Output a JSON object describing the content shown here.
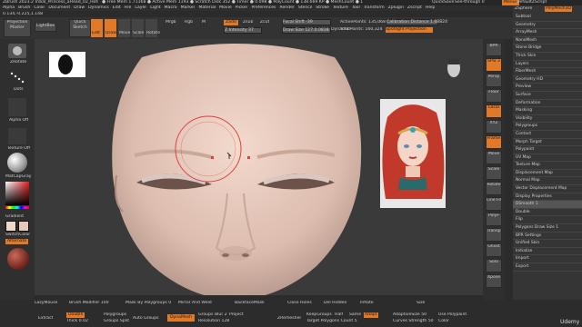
{
  "title_bar": {
    "app": "ZBrush 2023.2",
    "file": "Tribal_Princess_aHead_02_Hotsby",
    "stats": "● Free Mem 1.71168 ● Active Mem 1193 ● Scratch Disk 352 ● Timer ● 0.098 ● PolyCount ● 138.669 KP ● MeshCount ● 1",
    "quicksave": "QuickSave",
    "seethrough": "See-through  0",
    "menus_btn": "Menus",
    "script": "DefaultZScript"
  },
  "menu_bar": [
    "Alpha",
    "Brush",
    "Color",
    "Document",
    "Draw",
    "Dynamics",
    "Edit",
    "File",
    "Layer",
    "Light",
    "Macro",
    "Marker",
    "Material",
    "Movie",
    "Picker",
    "Preferences",
    "Render",
    "Stencil",
    "Stroke",
    "Texture",
    "Tool",
    "Transform",
    "Zplugin",
    "Zscript",
    "Help"
  ],
  "coords": "0.134,-0.225,1.148",
  "top_shelf": {
    "projection_master": "Projection Master",
    "lightbox": "LightBox",
    "quick_sketch": "Quick Sketch",
    "tools": [
      "Edit",
      "Draw",
      "Move",
      "Scale",
      "Rotate"
    ],
    "mrgb": "Mrgb",
    "rgb": "Rgb",
    "m": "M",
    "zadd": "Zadd",
    "zsub": "Zsub",
    "zcut": "Zcut",
    "z_intensity": "Z Intensity 37",
    "focal_shift": "Focal Shift -39",
    "draw_size": "Draw Size 127.0.0838",
    "dynamic": "Dynamic",
    "active_points": "ActivePoints: 135,068",
    "total_points": "TotalPoints: 160,324",
    "calibration": "Calibration Distance 1.68824",
    "spotlight": "Spotlight Projection"
  },
  "left_shelf": {
    "brush_label": "ZRotate",
    "stroke_label": "Dots",
    "alpha_label": "Alpha Off",
    "texture_label": "Texture Off",
    "material_label": "MatCapGray",
    "gradient": "Gradient",
    "switch_color": "SwitchColor",
    "alternate": "Alternate",
    "skin_shade": "BasicMaterial"
  },
  "right_shelf": {
    "buttons": [
      "BPR",
      "SPix 3",
      "Persp",
      "Floor",
      "Local",
      "XYZ",
      "Frame",
      "Move",
      "Scale",
      "Rotate",
      "Line Fill",
      "PolyF",
      "Transp",
      "Ghost",
      "Solo",
      "Xpose"
    ]
  },
  "subtool_menu": {
    "header_left": "ZSphere",
    "header_right": "PolyMesh3D",
    "items": [
      "Subtool",
      "Geometry",
      "ArrayMesh",
      "NanoMesh",
      "Stone Bridge",
      "Thick Skin",
      "Layers",
      "FiberMesh",
      "Geometry HD",
      "Preview",
      "Surface",
      "Deformation",
      "Masking",
      "Visibility",
      "Polygroups",
      "Contact",
      "Morph Target",
      "Polypaint",
      "UV Map",
      "Texture Map",
      "Displacement Map",
      "Normal Map",
      "Vector Displacement Map",
      "Display Properties"
    ],
    "dsmooth": "DSmooth 1",
    "double": "Double",
    "flip": "Flip",
    "polygons_draw_size": "Polygons Draw Size 1",
    "bpr_settings": "BPR Settings",
    "bottom_items": [
      "Unified Skin",
      "Initialize",
      "Import",
      "Export"
    ]
  },
  "bottom_shelf": {
    "row1": [
      "LazyMouse",
      "Brush Modifier 100",
      "Mask By Polygroups 0",
      "Mirror And Weld",
      "BackfaceMask",
      "Close Holes",
      "Del Hidden",
      "Inflate",
      "Size"
    ],
    "extract": "Extract",
    "double": "Double",
    "thick": "Thick 0.02",
    "polygroups": "Polygroups",
    "groups_split": "Groups Split",
    "auto_groups": "Auto Groups",
    "dynamesh": "DynaMesh",
    "groups": "Groups",
    "blur": "Blur 2",
    "project": "Project",
    "resolution": "Resolution 128",
    "zremesher": "ZRemesher",
    "keep_groups": "KeepGroups",
    "half": "Half",
    "same": "Same",
    "adapt": "Adapt",
    "target_polygons": "Target Polygons Count 5",
    "adaptive_size": "AdaptiveSize 50",
    "curves_strength": "Curves Strength 50",
    "use_polypaint": "Use Polypaint",
    "color": "Color"
  },
  "udemy": "Udemy",
  "colors": {
    "accent": "#e07a28",
    "face": "#e8c8b8",
    "brush_ring": "#e04040",
    "hair": "#c0392b"
  }
}
